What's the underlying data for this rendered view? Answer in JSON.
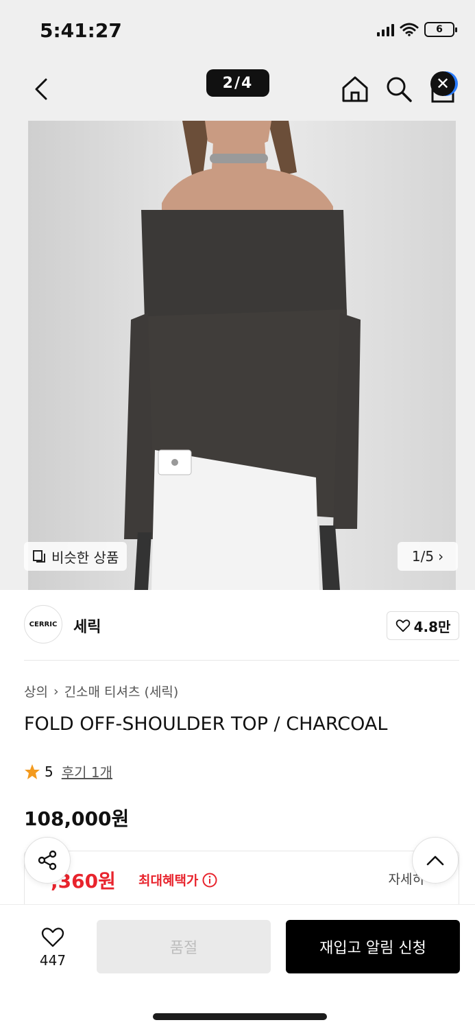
{
  "status_bar": {
    "time": "5:41:27",
    "battery": "6"
  },
  "nav": {
    "page_counter": "2/4"
  },
  "image": {
    "similar_label": "비슷한 상품",
    "counter": "1/5",
    "counter_arrow": "›"
  },
  "brand": {
    "logo_text": "CERRIC",
    "name": "세릭",
    "likes": "4.8만"
  },
  "product": {
    "breadcrumb_parent": "상의",
    "breadcrumb_sep": "›",
    "breadcrumb_child": "긴소매 티셔츠 (세릭)",
    "title": "FOLD OFF-SHOULDER TOP / CHARCOAL",
    "rating": "5",
    "review_link": "후기 1개",
    "price": "108,000원"
  },
  "benefit": {
    "price": ",360원",
    "label": "최대혜택가",
    "detail": "자세히"
  },
  "bottom": {
    "wish_count": "447",
    "soldout_label": "품절",
    "restock_label": "재입고 알림 신청"
  },
  "colors": {
    "accent_red": "#e8242d",
    "star": "#f39a1e",
    "primary": "#000000",
    "disabled": "#eaeaea"
  },
  "icons": [
    "back-icon",
    "home-icon",
    "search-icon",
    "cart-icon",
    "close-icon",
    "similar-icon",
    "heart-icon",
    "star-icon",
    "info-icon",
    "share-icon",
    "chevron-up-icon"
  ]
}
